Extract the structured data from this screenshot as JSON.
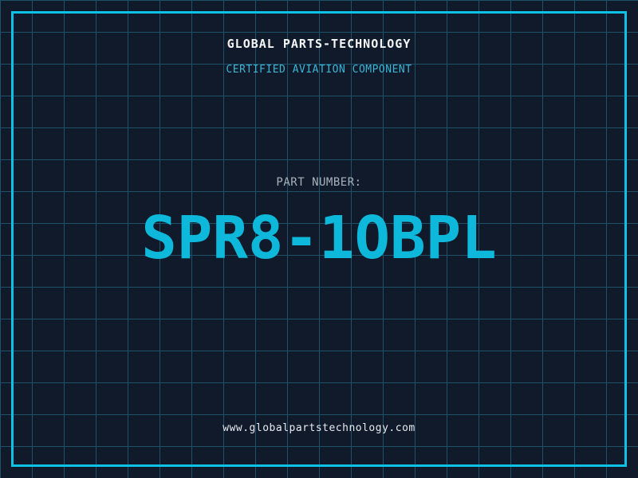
{
  "colors": {
    "background": "#101a2b",
    "grid_line": "#1f5268",
    "frame": "#0cc2e6",
    "title": "#f4f6f6",
    "subtitle": "#3ab6d6",
    "label": "#a8b2bb",
    "part_number": "#0db8da",
    "url": "#e6ebee"
  },
  "header": {
    "title": "GLOBAL PARTS-TECHNOLOGY",
    "subtitle": "CERTIFIED AVIATION COMPONENT"
  },
  "part": {
    "label": "PART NUMBER:",
    "number": "SPR8-1OBPL"
  },
  "footer": {
    "url": "www.globalpartstechnology.com"
  }
}
